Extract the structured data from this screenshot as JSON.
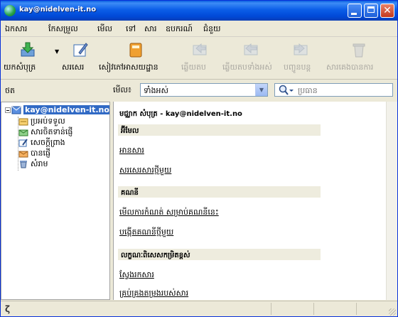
{
  "window": {
    "title": "kay@nidelven-it.no"
  },
  "menu": [
    "ឯកសារ",
    "កែសម្រួល",
    "មើល",
    "ទៅ",
    "សារ",
    "ឧបករណ៍",
    "ជំនួយ"
  ],
  "toolbar": {
    "get_mail": "យកសំបុត្រ",
    "write": "សរសេរ",
    "address_book": "សៀវភៅអាសយដ្ឋាន",
    "reply": "ឆ្លើយតប",
    "reply_all": "ឆ្លើយតបទាំងអស់",
    "forward": "បញ្ជូនបន្ត",
    "delete": "សារគេងបានការ"
  },
  "filter": {
    "folders_label": "ថត",
    "view_label": "មើល៖",
    "view_value": "ទាំងអស់",
    "search_placeholder": "ប្រធាន"
  },
  "folders": {
    "account": "kay@nidelven-it.no",
    "items": [
      "ប្រអប់ទទួល",
      "សារចិតទាន់ផ្ញើ",
      "សេចក្តីព្រាង",
      "បានផ្ញើ",
      "សំរាម"
    ]
  },
  "main": {
    "title": "មជ្ឈាក សំបុត្រ - kay@nidelven-it.no",
    "sections": [
      {
        "header": "អ៊ីមែល",
        "links": [
          "អានសារ",
          "សរសេរសារថ្មីមួយ"
        ]
      },
      {
        "header": "គណនី",
        "links": [
          "មើលការកំណត់ សម្រាប់គណនីនេះ",
          "បង្កើតគណនីថ្មីមួយ"
        ]
      },
      {
        "header": "លក្ខណៈពិសេសកម្រិតខ្ពស់",
        "links": [
          "ស្វែងរកសារ",
          "គ្រប់គ្រងតម្រងរបស់សារ"
        ]
      }
    ]
  },
  "colors": {
    "titlebar": "#0b5ee8",
    "selection": "#316ac5",
    "section_bg": "#eeecde"
  }
}
